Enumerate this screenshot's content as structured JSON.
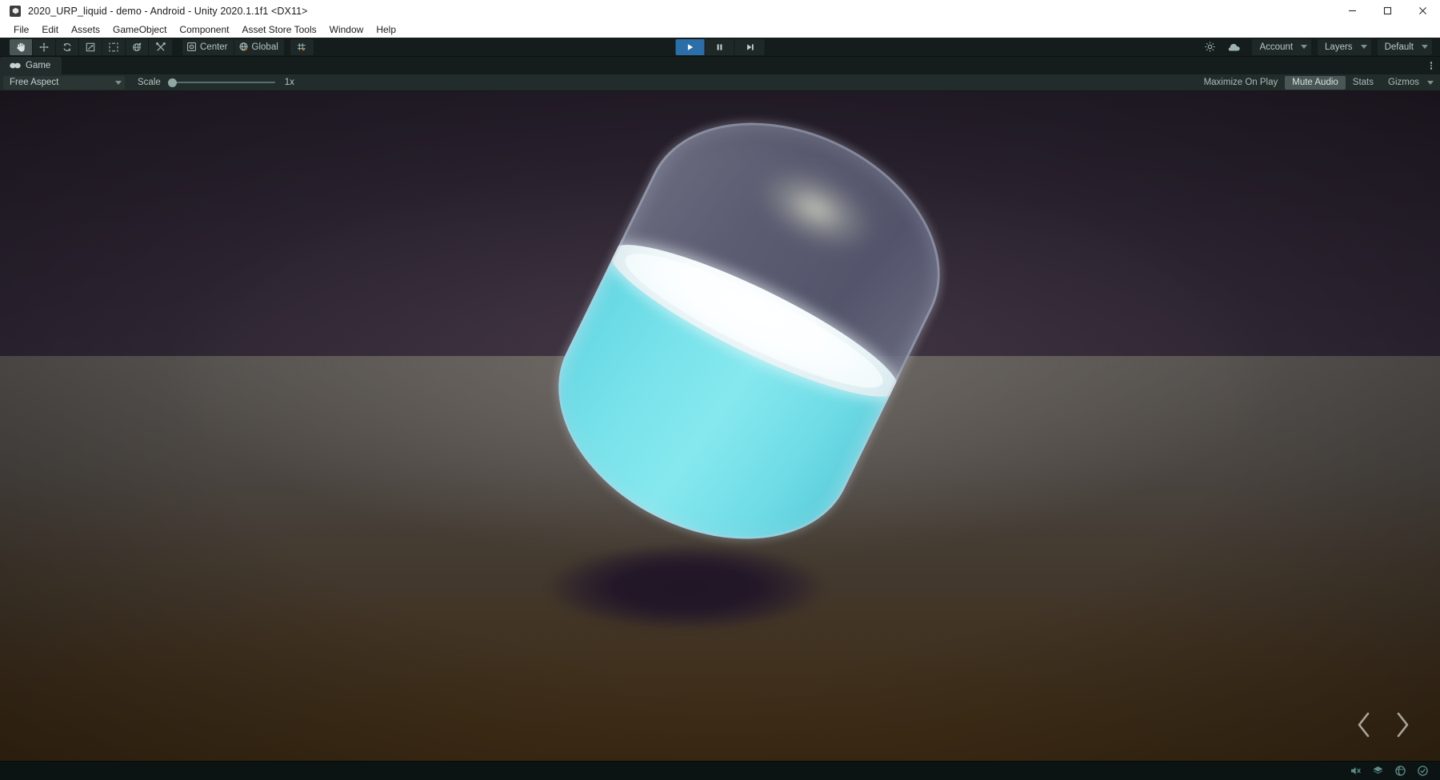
{
  "window": {
    "title": "2020_URP_liquid - demo - Android - Unity 2020.1.1f1 <DX11>",
    "app_icon": "unity-icon",
    "controls": {
      "minimize": "minimize-icon",
      "maximize": "maximize-icon",
      "close": "close-icon"
    }
  },
  "menubar": {
    "items": [
      {
        "label": "File"
      },
      {
        "label": "Edit"
      },
      {
        "label": "Assets"
      },
      {
        "label": "GameObject"
      },
      {
        "label": "Component"
      },
      {
        "label": "Asset Store Tools"
      },
      {
        "label": "Window"
      },
      {
        "label": "Help"
      }
    ]
  },
  "toolbar": {
    "tools": [
      {
        "name": "hand-tool",
        "icon": "hand-icon",
        "active": true
      },
      {
        "name": "move-tool",
        "icon": "move-icon",
        "active": false
      },
      {
        "name": "rotate-tool",
        "icon": "rotate-icon",
        "active": false
      },
      {
        "name": "scale-tool",
        "icon": "scale-icon",
        "active": false
      },
      {
        "name": "rect-tool",
        "icon": "rect-transform-icon",
        "active": false
      },
      {
        "name": "transform-tool",
        "icon": "transform-icon",
        "active": false
      },
      {
        "name": "custom-tool",
        "icon": "wrench-screwdriver-icon",
        "active": false
      }
    ],
    "pivot_mode": "Center",
    "pivot_rotation": "Global",
    "grid_snap_icon": "grid-snap-icon",
    "playback": {
      "play": "play-icon",
      "pause": "pause-icon",
      "step": "step-icon",
      "is_playing": true
    },
    "cloud_icon": "cloud-icon",
    "collab_icon": "services-icon",
    "account_label": "Account",
    "layers_label": "Layers",
    "layout_label": "Default"
  },
  "game_tab": {
    "label": "Game",
    "icon": "game-view-icon",
    "kebab": "more-options-icon"
  },
  "game_toolbar": {
    "aspect": "Free Aspect",
    "scale_label": "Scale",
    "scale_value": "1x",
    "scale_percent": 0,
    "maximize_on_play": "Maximize On Play",
    "mute_audio": "Mute Audio",
    "mute_audio_on": true,
    "stats": "Stats",
    "gizmos": "Gizmos"
  },
  "scene": {
    "description": "Tilted translucent capsule containing cyan liquid with white surface, cast shadow on gray-brown ground, dark purple sky",
    "colors": {
      "sky": "#2b2330",
      "ground_near": "#55514e",
      "ground_far": "#2b2117",
      "liquid": "#78e2ea",
      "liquid_surface": "#ffffff",
      "glass": "#6a6c88",
      "shadow": "#22162a"
    },
    "nav_prev_icon": "chevron-left-icon",
    "nav_next_icon": "chevron-right-icon"
  },
  "statusbar": {
    "icons": [
      {
        "name": "mute-audio-status-icon"
      },
      {
        "name": "layers-status-icon"
      },
      {
        "name": "collab-status-icon"
      },
      {
        "name": "ready-status-icon"
      }
    ]
  }
}
